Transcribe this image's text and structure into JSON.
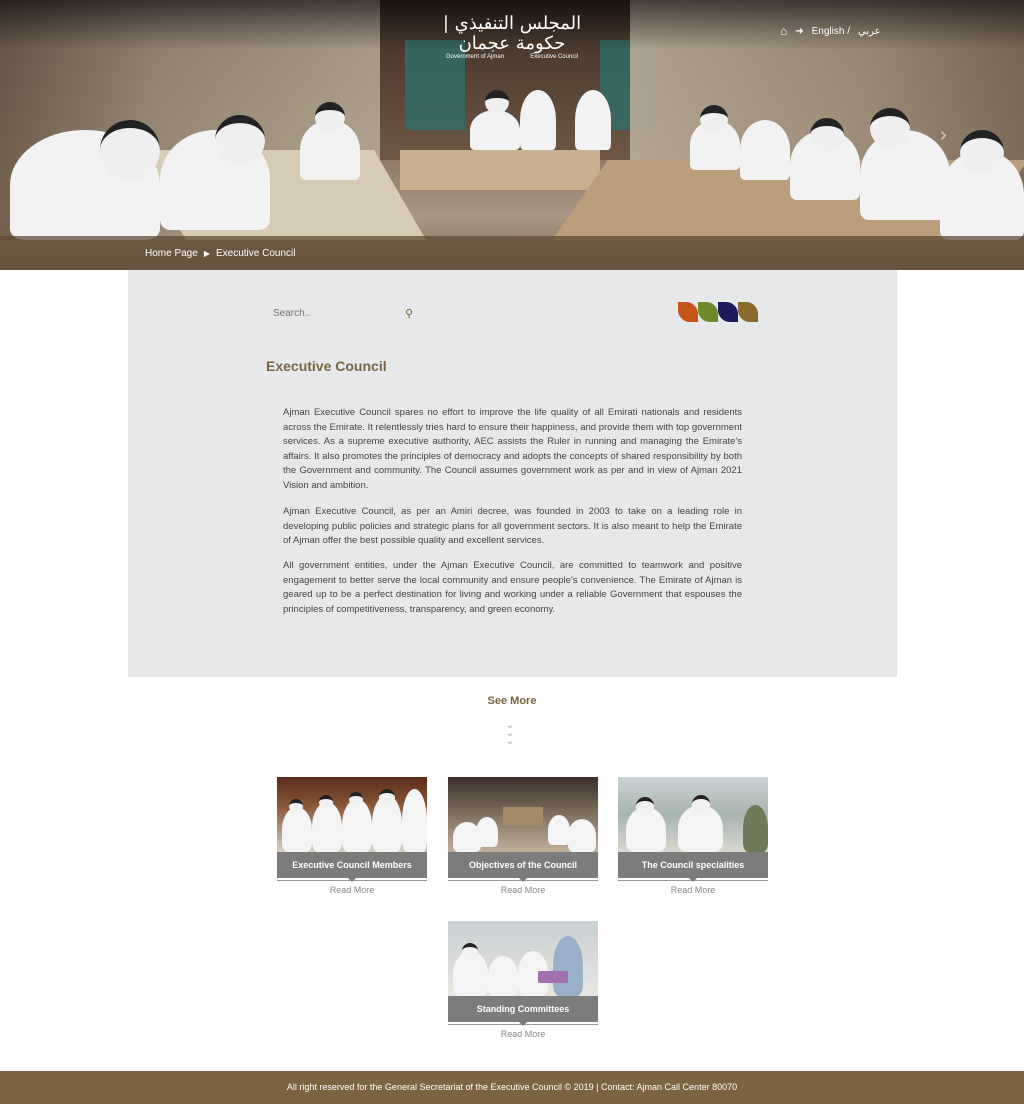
{
  "header": {
    "logo_ar": "المجلس التنفيذي | حكومة عجمان",
    "logo_en_left": "Government of Ajman",
    "logo_en_right": "Executive Council",
    "lang_english": "English /",
    "lang_arabic": "عربي",
    "home_icon": "home-icon",
    "arrow_icon": "arrow-right-icon"
  },
  "breadcrumb": {
    "home": "Home Page",
    "current": "Executive Council"
  },
  "search": {
    "placeholder": "Search.."
  },
  "color_swatches": [
    "#c5561a",
    "#6b8b2a",
    "#1a1a5c",
    "#8a6a2a"
  ],
  "main": {
    "title": "Executive Council",
    "paragraphs": [
      "Ajman Executive Council spares no effort to improve the life quality of all Emirati nationals and residents across the Emirate. It relentlessly tries hard to ensure their happiness, and provide them with top government services. As a supreme executive authority, AEC assists the Ruler in running and managing the Emirate's affairs. It also promotes the principles of democracy and adopts the concepts of shared responsibility by both the Government and community. The Council assumes government work as per and in view of Ajman 2021 Vision and ambition.",
      "Ajman Executive Council, as per an Amiri decree, was founded in 2003 to take on a leading role in developing public policies and strategic plans for all government sectors. It is also meant to help the Emirate of Ajman offer the best possible quality and excellent services.",
      "All government entities, under the Ajman Executive Council, are committed to teamwork and positive engagement to better serve the local community and ensure people's convenience. The Emirate of Ajman is geared up to be a perfect destination for living and working under a reliable Government that espouses the principles of competitiveness, transparency, and green economy."
    ]
  },
  "see_more": "See More",
  "cards": [
    {
      "label": "Executive Council Members",
      "read_more": "Read More"
    },
    {
      "label": "Objectives of the Council",
      "read_more": "Read More"
    },
    {
      "label": "The Council specialities",
      "read_more": "Read More"
    },
    {
      "label": "Standing Committees",
      "read_more": "Read More"
    }
  ],
  "footer": {
    "text": "All right reserved for the General Secretariat of the Executive Council © 2019 | Contact: Ajman Call Center 80070"
  }
}
